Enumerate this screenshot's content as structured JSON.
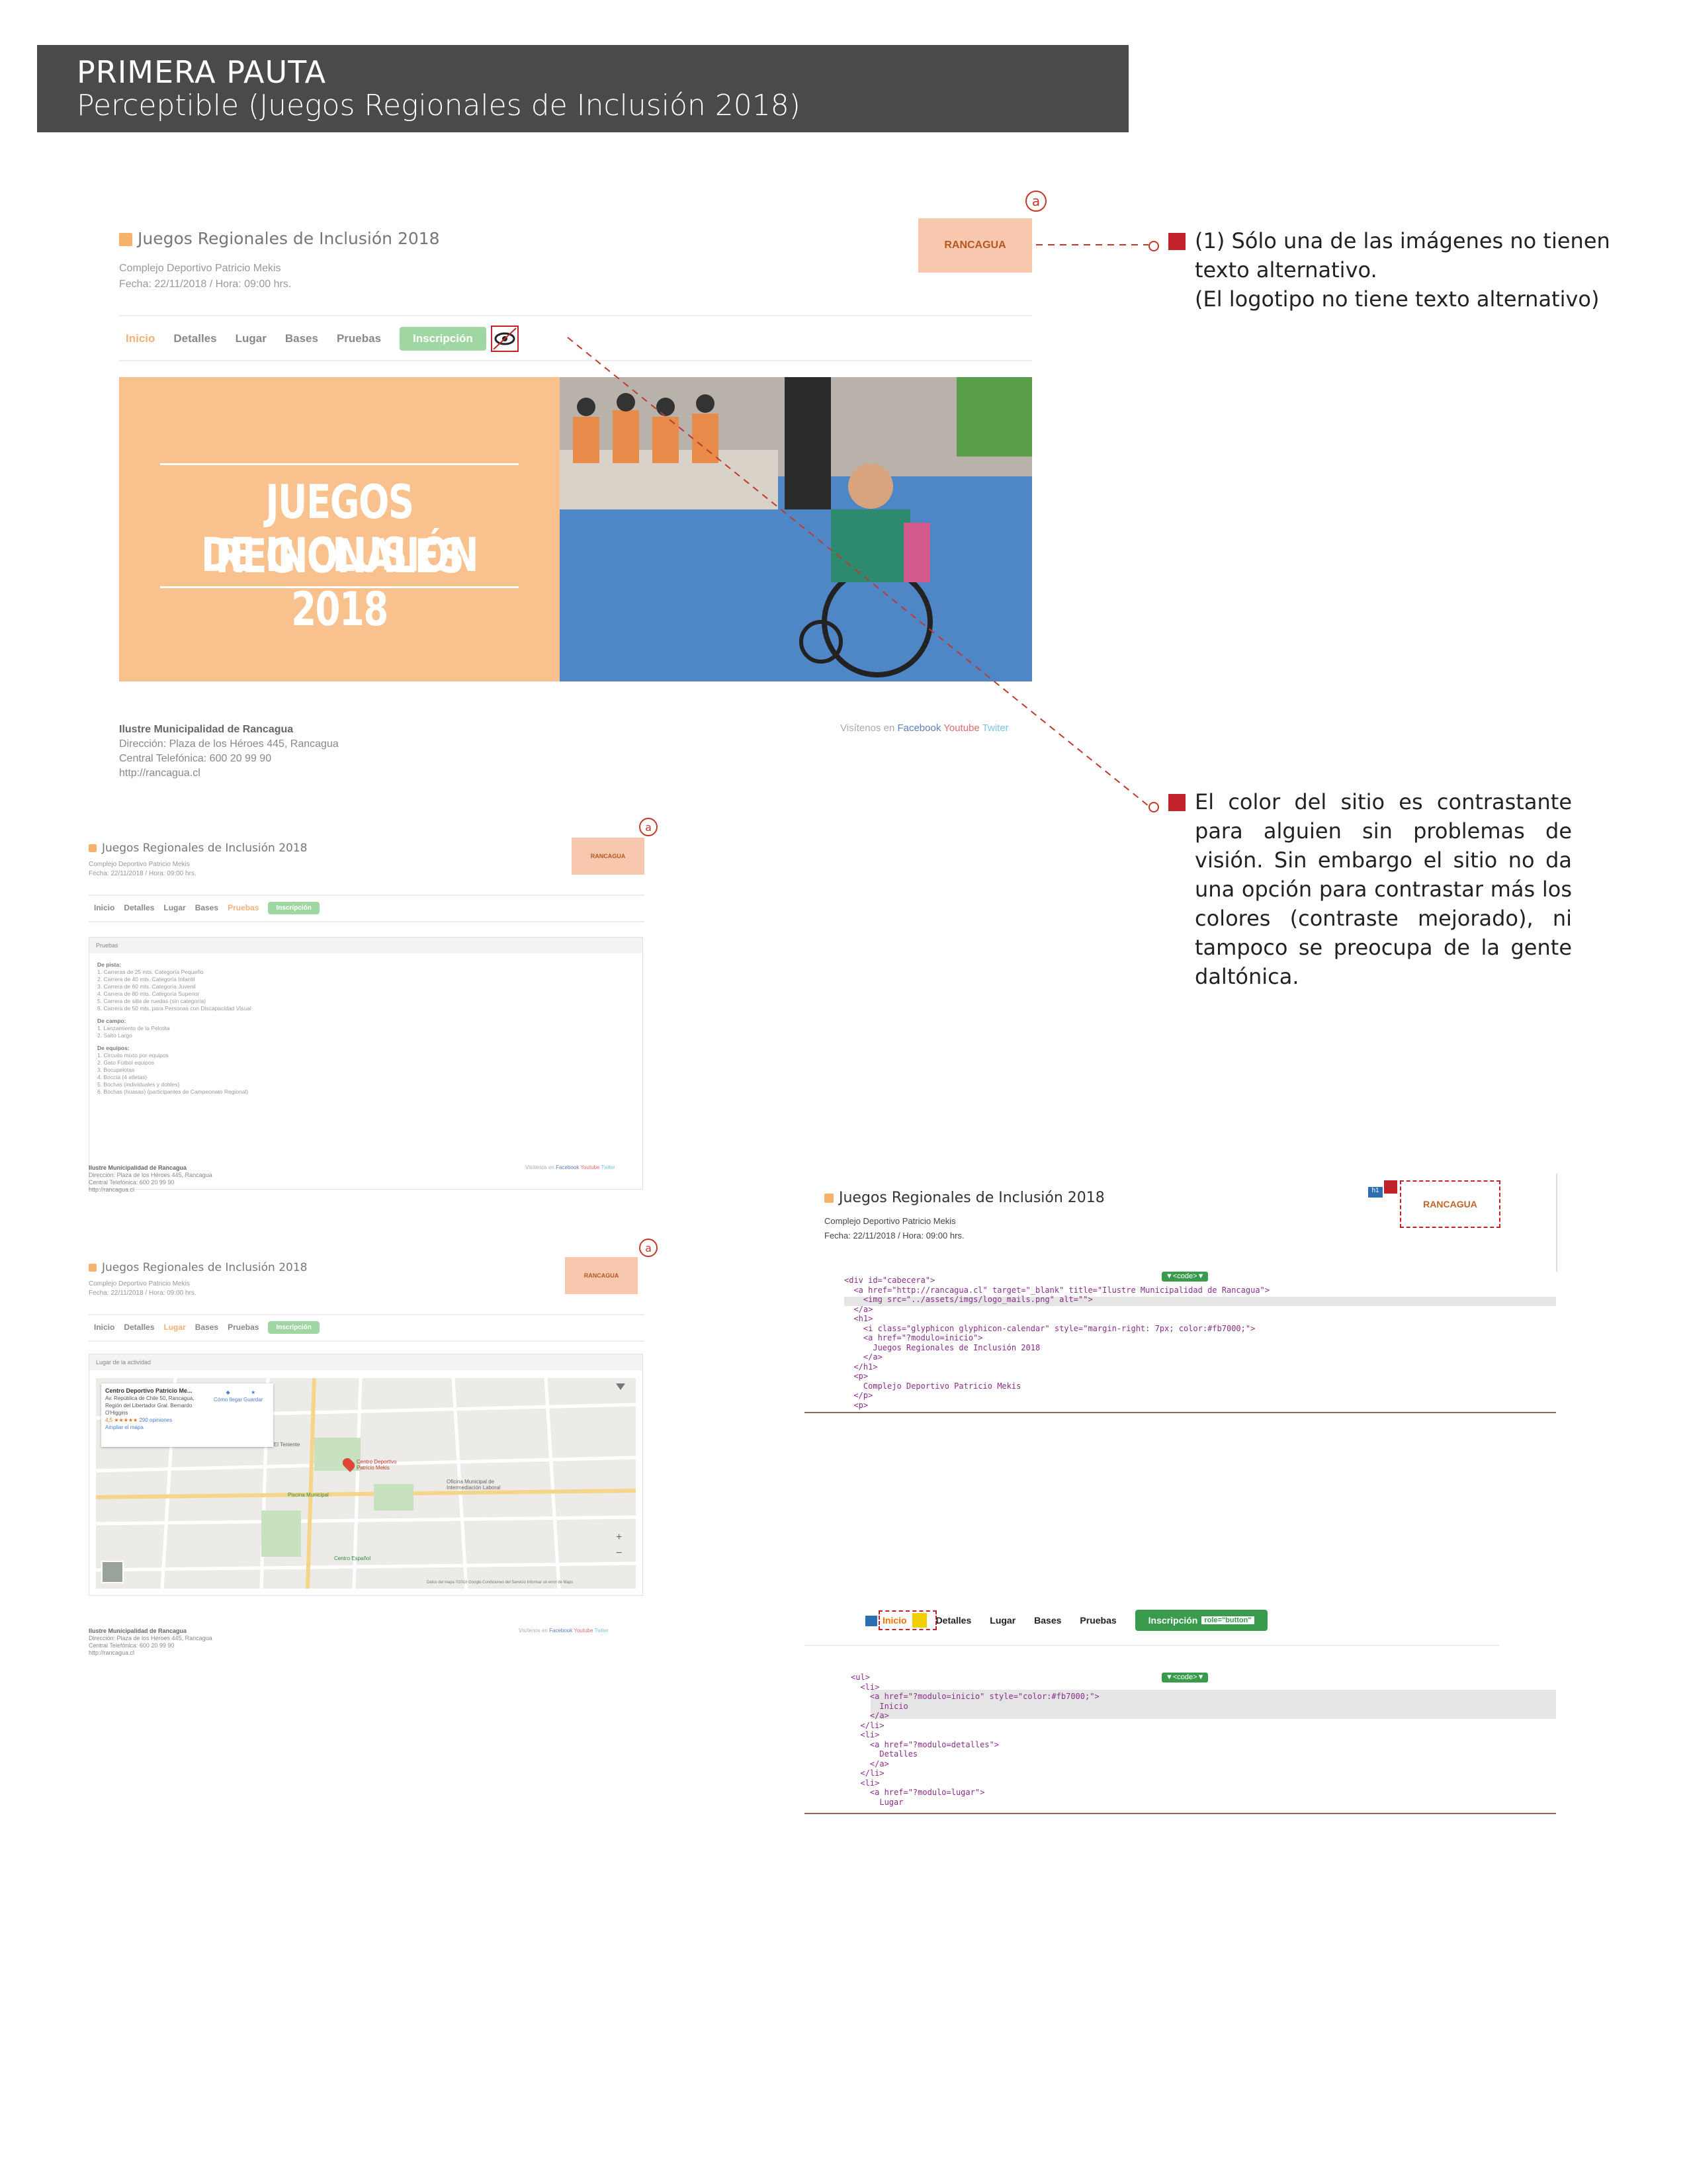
{
  "header": {
    "title": "PRIMERA PAUTA",
    "subtitle": "Perceptible (Juegos Regionales de Inclusión 2018)"
  },
  "site": {
    "title": "Juegos Regionales de Inclusión 2018",
    "venue": "Complejo Deportivo Patricio Mekis",
    "date": "Fecha: 22/11/2018 / Hora: 09:00 hrs.",
    "logo_text": "RANCAGUA",
    "nav": [
      "Inicio",
      "Detalles",
      "Lugar",
      "Bases",
      "Pruebas"
    ],
    "nav_button": "Inscripción",
    "banner_line1": "JUEGOS REGIONALES",
    "banner_line2": "DE INCLUSIÓN 2018",
    "footer_org": "Ilustre Municipalidad de Rancagua",
    "footer_address": "Dirección: Plaza de los Héroes 445, Rancagua",
    "footer_phone": "Central Telefónica: 600 20 99 90",
    "footer_url": "http://rancagua.cl",
    "social_label": "Visítenos en",
    "social": [
      "Facebook",
      "Youtube",
      "Twiter"
    ]
  },
  "annotation_marker": "a",
  "notes": {
    "note1_lines": [
      "(1) Sólo una de las imágenes no tienen",
      "texto alternativo.",
      "(El logotipo no tiene texto alternativo)"
    ],
    "note2_lines": [
      "El color del sitio es contrastante",
      "para alguien sin problemas de",
      "visión. Sin embargo el sitio no da",
      "una opción para contrastar más los",
      "colores (contraste mejorado), ni",
      "tampoco se preocupa de la gente",
      "daltónica."
    ]
  },
  "pruebas_page": {
    "panel_title": "Pruebas",
    "sections": [
      {
        "heading": "De pista:",
        "items": [
          "1. Carreras de 25 mts. Categoría Pequeño",
          "2. Carrera de 40 mts. Categoría Infantil",
          "3. Carrera de 60 mts. Categoría Juvenil",
          "4. Carrera de 80 mts. Categoría Superior",
          "5. Carrera de silla de ruedas (sin categoría)",
          "6. Carrera de 50 mts. para Personas con Discapacidad Visual"
        ]
      },
      {
        "heading": "De campo:",
        "items": [
          "1. Lanzamiento de la Pelotita",
          "2. Salto Largo"
        ]
      },
      {
        "heading": "De equipos:",
        "items": [
          "1. Circuito mixto por equipos",
          "2. Gato Fútbol equipos",
          "3. Bocupelotas",
          "4. Boccia (4 atletas)",
          "5. Bochas (individuales y dobles)",
          "6. Bochas (huasas) (participantes de Campeonato Regional)"
        ]
      }
    ]
  },
  "lugar_page": {
    "panel_title": "Lugar de la actividad",
    "place_name": "Centro Deportivo Patricio Me...",
    "place_address": "Av. República de Chile 50, Rancagua, Región del Libertador Gral. Bernardo O'Higgins",
    "rating": "4,5 ★★★★★",
    "reviews": "290 opiniones",
    "larger_map": "Ampliar el mapa",
    "directions": "Cómo llegar",
    "save": "Guardar",
    "map_labels": [
      "Centro Deportivo Patricio Mekis",
      "Piscina Municipal",
      "Oficina Municipal de Intermediación Laboral",
      "Centro Español",
      "Estadio El Teniente"
    ],
    "zoom_in": "+",
    "zoom_out": "−",
    "attribution": "Datos del mapa ©2018 Google  Condiciones del Servicio  Informar un error de Maps"
  },
  "code1": {
    "badge": "▼<code>▼",
    "lines": [
      "<div id=\"cabecera\">",
      "  <a href=\"http://rancagua.cl\" target=\"_blank\" title=\"Ilustre Municipalidad de Rancagua\">",
      "    <img src=\"../assets/imgs/logo_mails.png\" alt=\"\">",
      "  </a>",
      "  <h1>",
      "    <i class=\"glyphicon glyphicon-calendar\" style=\"margin-right: 7px; color:#fb7000;\">",
      "    <a href=\"?modulo=inicio\">",
      "      Juegos Regionales de Inclusión 2018",
      "    </a>",
      "  </h1>",
      "  <p>",
      "    Complejo Deportivo Patricio Mekis",
      "  </p>",
      "  <p>"
    ]
  },
  "code2": {
    "badge": "▼<code>▼",
    "role_label": "role=\"button\"",
    "lines": [
      "<ul>",
      "  <li>",
      "    <a href=\"?modulo=inicio\" style=\"color:#fb7000;\">",
      "      Inicio",
      "    </a>",
      "  </li>",
      "  <li>",
      "    <a href=\"?modulo=detalles\">",
      "      Detalles",
      "    </a>",
      "  </li>",
      "  <li>",
      "    <a href=\"?modulo=lugar\">",
      "      Lugar"
    ]
  },
  "colors": {
    "accent": "#c0242a",
    "orange": "#fb7000",
    "green": "#3a9b4c",
    "peach": "#f8c18e"
  }
}
